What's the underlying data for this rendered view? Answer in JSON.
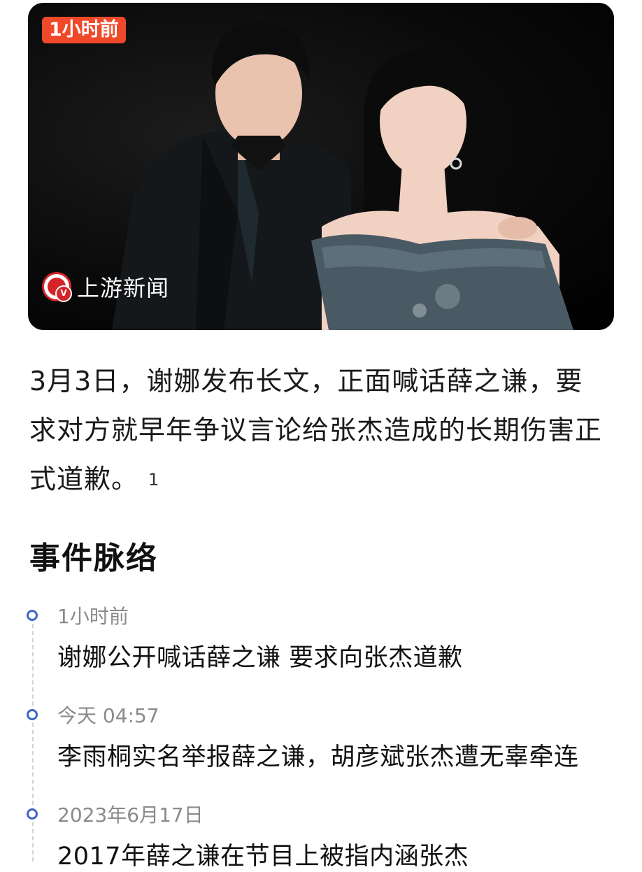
{
  "hero": {
    "time_badge": "1小时前",
    "source_name": "上游新闻",
    "source_logo": "youpin-news-logo",
    "photo_alt": "news-photo-couple"
  },
  "summary": {
    "text": "3月3日，谢娜发布长文，正面喊话薛之谦，要求对方就早年争议言论给张杰造成的长期伤害正式道歉。",
    "ref": "1"
  },
  "timeline": {
    "title": "事件脉络",
    "accent": "#3f65c8",
    "items": [
      {
        "time": "1小时前",
        "headline": "谢娜公开喊话薛之谦 要求向张杰道歉"
      },
      {
        "time": "今天 04:57",
        "headline": "李雨桐实名举报薛之谦，胡彦斌张杰遭无辜牵连"
      },
      {
        "time": "2023年6月17日",
        "headline": "2017年薛之谦在节目上被指内涵张杰"
      }
    ]
  }
}
